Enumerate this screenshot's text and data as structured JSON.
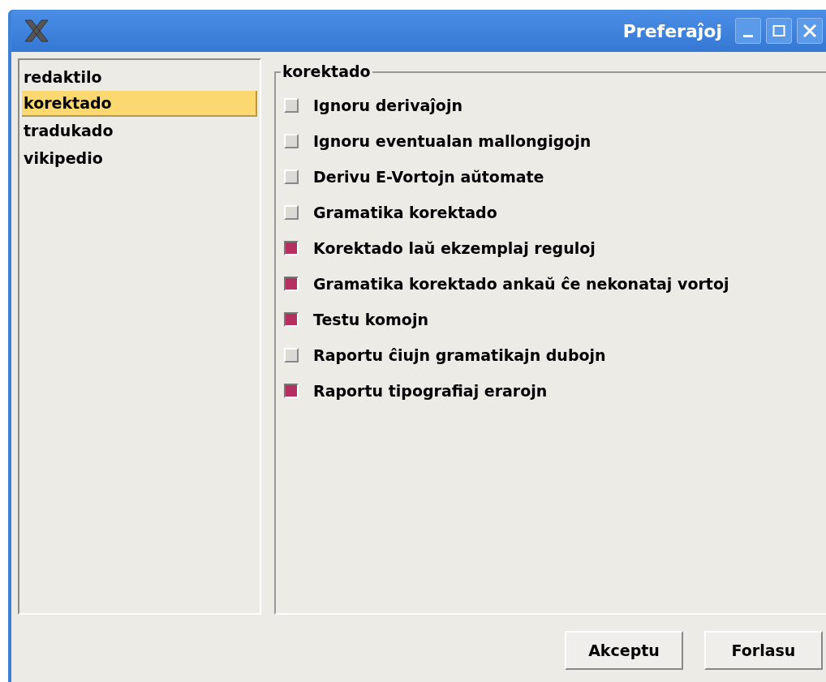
{
  "window": {
    "title": "Preferaĵoj"
  },
  "sidebar": {
    "items": [
      {
        "label": "redaktilo",
        "selected": false
      },
      {
        "label": "korektado",
        "selected": true
      },
      {
        "label": "tradukado",
        "selected": false
      },
      {
        "label": "vikipedio",
        "selected": false
      }
    ]
  },
  "group": {
    "title": "korektado",
    "options": [
      {
        "label": "Ignoru derivaĵojn",
        "checked": false
      },
      {
        "label": "Ignoru eventualan mallongigojn",
        "checked": false
      },
      {
        "label": "Derivu E-Vortojn aŭtomate",
        "checked": false
      },
      {
        "label": "Gramatika korektado",
        "checked": false
      },
      {
        "label": "Korektado laŭ ekzemplaj reguloj",
        "checked": true
      },
      {
        "label": "Gramatika korektado ankaŭ ĉe nekonataj vortoj",
        "checked": true
      },
      {
        "label": "Testu komojn",
        "checked": true
      },
      {
        "label": "Raportu ĉiujn gramatikajn dubojn",
        "checked": false
      },
      {
        "label": "Raportu tipografiaj erarojn",
        "checked": true
      }
    ]
  },
  "buttons": [
    "Akceptu",
    "Forlasu"
  ]
}
